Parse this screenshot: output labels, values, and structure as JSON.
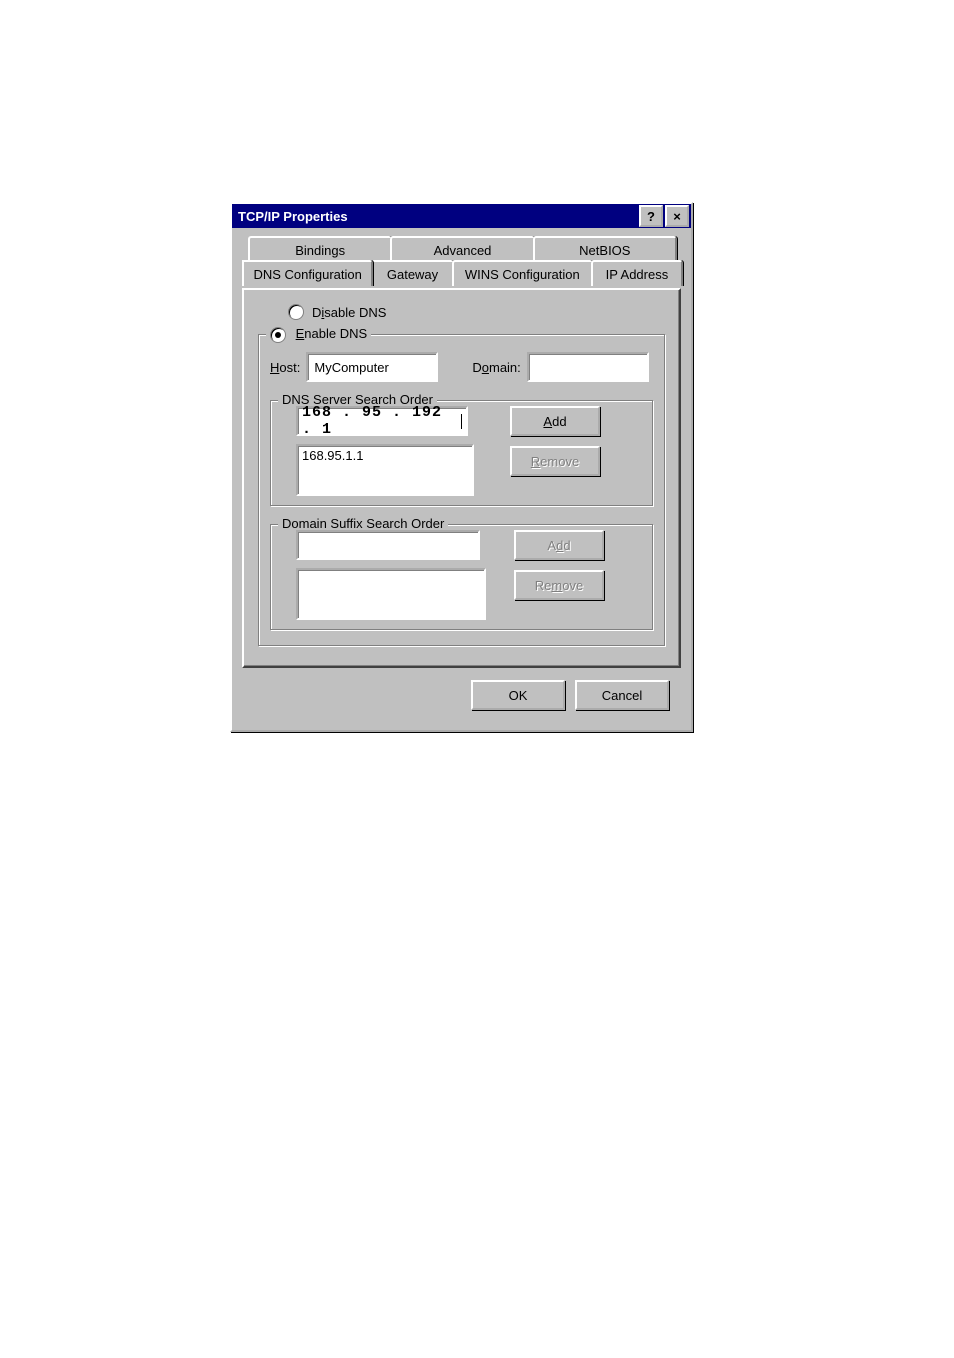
{
  "title": "TCP/IP Properties",
  "titlebar": {
    "help_glyph": "?",
    "close_glyph": "×"
  },
  "tabs": {
    "row_back": [
      "Bindings",
      "Advanced",
      "NetBIOS"
    ],
    "row_front": [
      "DNS Configuration",
      "Gateway",
      "WINS Configuration",
      "IP Address"
    ],
    "active": "DNS Configuration"
  },
  "dns": {
    "disable_label_pre": "D",
    "disable_ul": "i",
    "disable_label_post": "sable DNS",
    "enable_ul": "E",
    "enable_label_post": "nable DNS",
    "selected": "enable",
    "host_ul": "H",
    "host_label_post": "ost:",
    "host_value": "MyComputer",
    "domain_label_pre": "D",
    "domain_ul": "o",
    "domain_label_post": "main:",
    "domain_value": "",
    "group_servers_title": "DNS Server Search Order",
    "ip_input": "168 . 95 . 192 .  1",
    "add_ul": "A",
    "add_post": "dd",
    "remove_pre": "",
    "remove_ul": "R",
    "remove_post": "emove",
    "server_list_item0": "168.95.1.1",
    "group_suffix_title": "Domain Suffix Search Order",
    "suffix_input": "",
    "suffix_add_pre": "A",
    "suffix_add_ul": "d",
    "suffix_add_post": "d",
    "suffix_remove_pre": "Re",
    "suffix_remove_ul": "m",
    "suffix_remove_post": "ove"
  },
  "buttons": {
    "ok": "OK",
    "cancel": "Cancel"
  }
}
